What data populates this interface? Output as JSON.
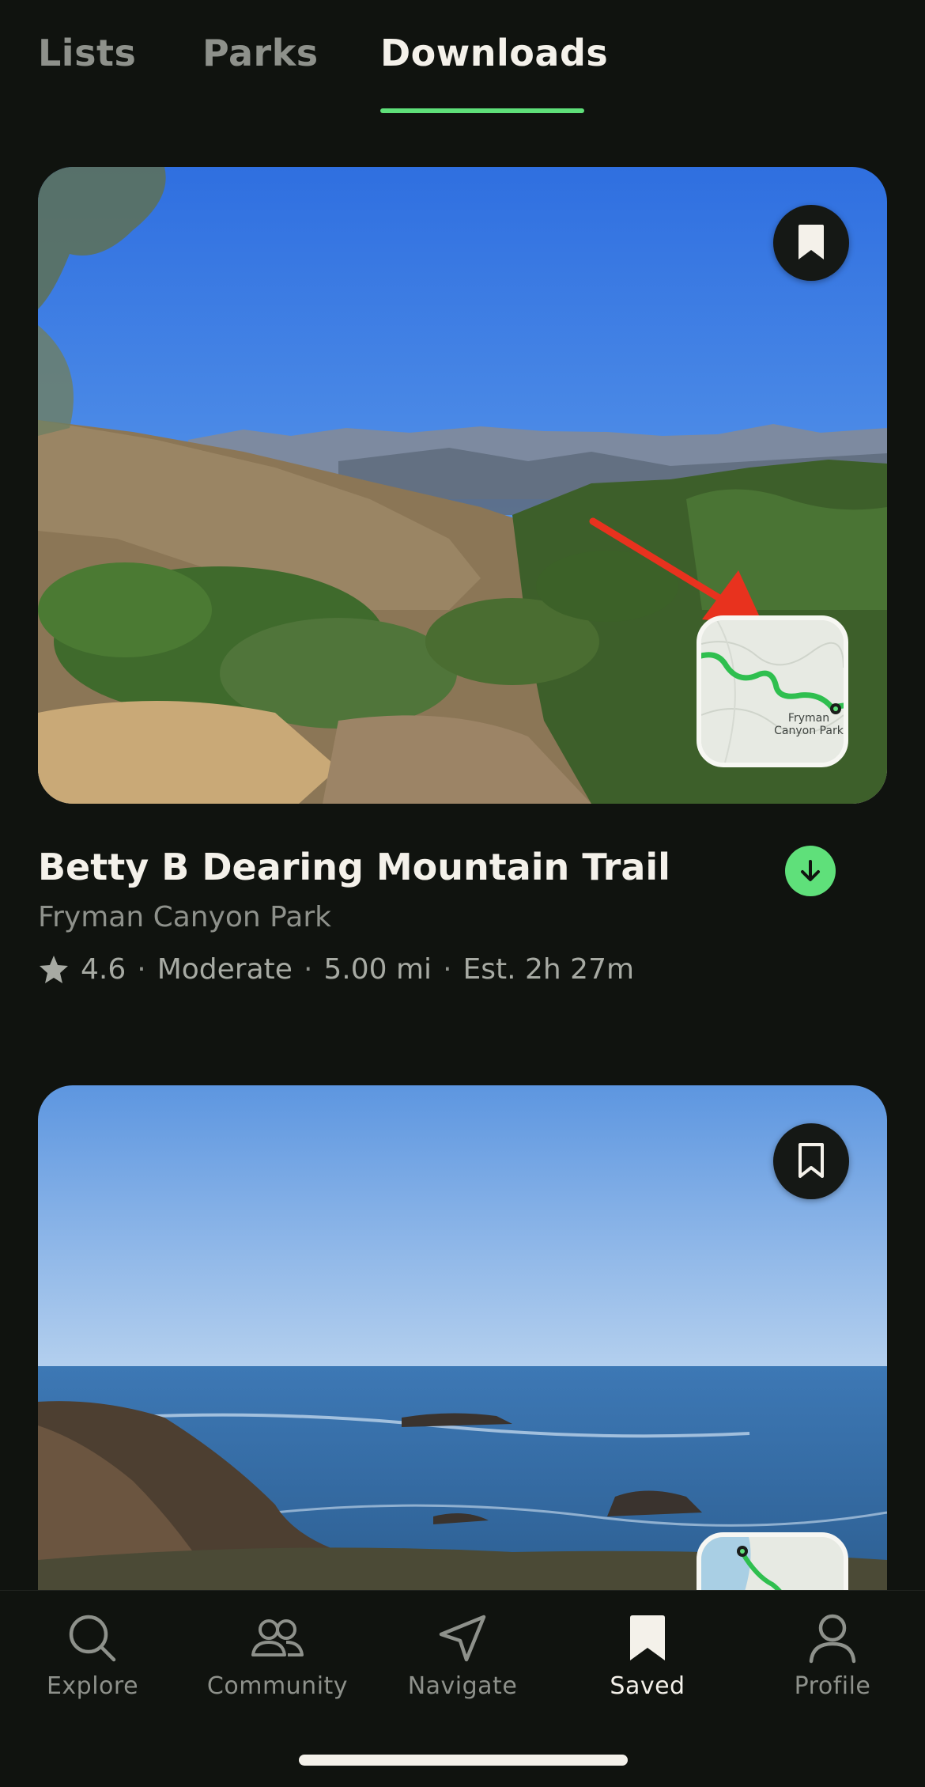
{
  "tabs": {
    "items": [
      {
        "label": "Lists",
        "active": false
      },
      {
        "label": "Parks",
        "active": false
      },
      {
        "label": "Downloads",
        "active": true
      }
    ],
    "accent_color": "#5fe07a"
  },
  "trails": [
    {
      "title": "Betty B Dearing Mountain Trail",
      "park": "Fryman Canyon Park",
      "rating": "4.6",
      "difficulty": "Moderate",
      "distance": "5.00 mi",
      "est_time": "Est. 2h 27m",
      "saved": true,
      "downloaded": true,
      "map_label": "Fryman Canyon Park",
      "photo": "canyon-hillside-photo"
    },
    {
      "saved": false,
      "photo": "rocky-coastline-photo"
    }
  ],
  "nav": {
    "items": [
      {
        "label": "Explore",
        "icon": "search-icon",
        "active": false
      },
      {
        "label": "Community",
        "icon": "people-icon",
        "active": false
      },
      {
        "label": "Navigate",
        "icon": "navigate-arrow-icon",
        "active": false
      },
      {
        "label": "Saved",
        "icon": "bookmark-icon",
        "active": true
      },
      {
        "label": "Profile",
        "icon": "person-icon",
        "active": false
      }
    ]
  },
  "colors": {
    "background": "#10130f",
    "text_primary": "#f4f1ea",
    "text_secondary": "#8e918b",
    "accent": "#5fe07a",
    "annotation_arrow": "#e8321e"
  }
}
